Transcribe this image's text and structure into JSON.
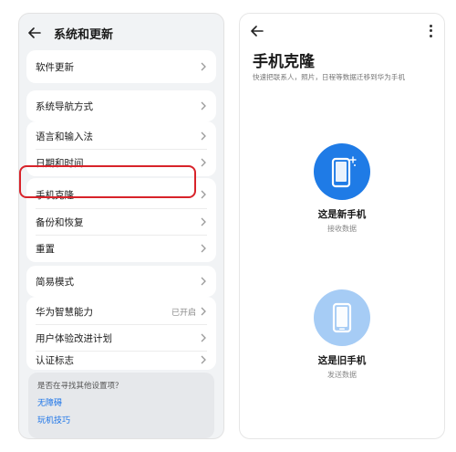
{
  "left": {
    "header_title": "系统和更新",
    "cards": [
      {
        "items": [
          {
            "label": "软件更新"
          }
        ]
      },
      {
        "items": [
          {
            "label": "系统导航方式"
          }
        ]
      },
      {
        "items": [
          {
            "label": "语言和输入法"
          },
          {
            "label": "日期和时间"
          }
        ]
      },
      {
        "items": [
          {
            "label": "手机克隆"
          },
          {
            "label": "备份和恢复"
          },
          {
            "label": "重置"
          }
        ]
      },
      {
        "items": [
          {
            "label": "简易模式"
          }
        ]
      },
      {
        "items": [
          {
            "label": "华为智慧能力",
            "value": "已开启"
          },
          {
            "label": "用户体验改进计划"
          },
          {
            "label": "认证标志"
          }
        ]
      }
    ],
    "help": {
      "question": "是否在寻找其他设置项？",
      "links": [
        "无障碍",
        "玩机技巧"
      ]
    }
  },
  "right": {
    "title": "手机克隆",
    "subtitle": "快速把联系人，照片，日程等数据迁移到华为手机",
    "options": [
      {
        "title": "这是新手机",
        "sub": "接收数据",
        "icon": "new-phone-icon"
      },
      {
        "title": "这是旧手机",
        "sub": "发送数据",
        "icon": "old-phone-icon"
      }
    ]
  },
  "colors": {
    "accent": "#1f7be6",
    "highlight": "#d8232a",
    "link": "#1a73e8"
  }
}
